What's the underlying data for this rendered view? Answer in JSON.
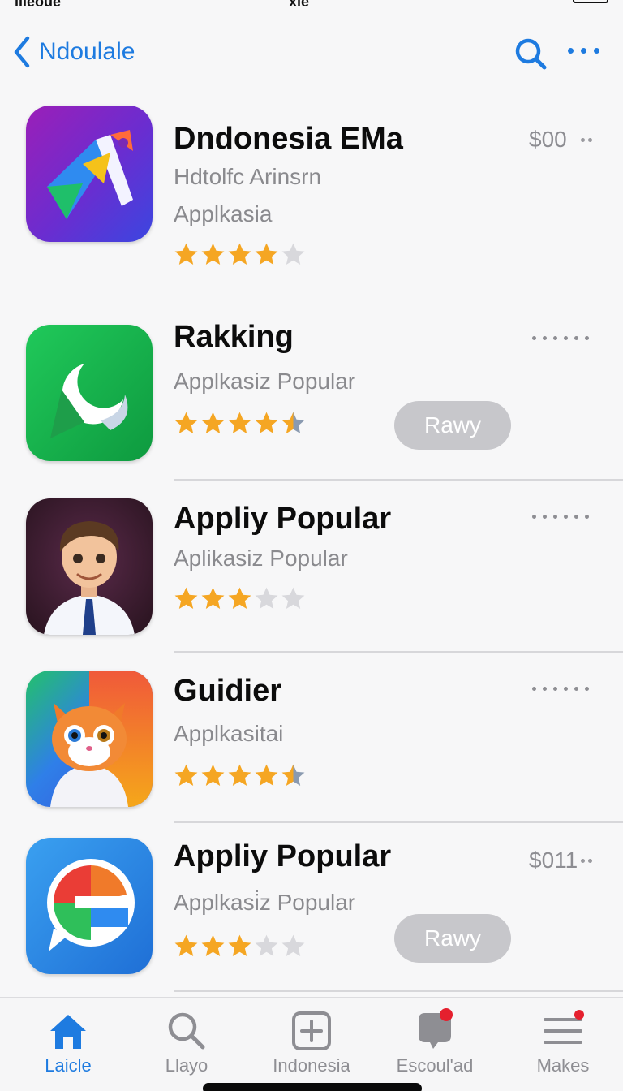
{
  "status_bar": {
    "left": "ıııeoue",
    "center": "xıe"
  },
  "nav": {
    "back_label": "Ndoulale"
  },
  "apps": [
    {
      "title": "Dndonesia EMa",
      "subtitle": "Hdtolfc Arinsrn",
      "category": "Applkasia",
      "rating": 4,
      "price": "$00",
      "action": ""
    },
    {
      "title": "Rakking",
      "subtitle": "Applkasiz Popular",
      "category": "",
      "rating": 4.5,
      "price": "",
      "action": "Rawy"
    },
    {
      "title": "Appliy Popular",
      "subtitle": "Aplikasiz Popular",
      "category": "",
      "rating": 3,
      "price": "",
      "action": ""
    },
    {
      "title": "Guidier",
      "subtitle": "Applkasitai",
      "category": "",
      "rating": 4.5,
      "price": "",
      "action": ""
    },
    {
      "title": "Appliy Popular",
      "subtitle": "Applkasi̇z Popular",
      "category": "",
      "rating": 3,
      "price": "$011",
      "action": "Rawy"
    }
  ],
  "tabs": [
    {
      "label": "Laicle",
      "icon": "house-icon",
      "active": true
    },
    {
      "label": "Llayo",
      "icon": "search-icon",
      "active": false
    },
    {
      "label": "Indonesia",
      "icon": "plus-square-icon",
      "active": false
    },
    {
      "label": "Escoul'ad",
      "icon": "speech-bubble-icon",
      "active": false,
      "badge": true
    },
    {
      "label": "Makes",
      "icon": "menu-lines-icon",
      "active": false,
      "badge": true
    }
  ],
  "colors": {
    "accent": "#1e7be0",
    "star_gold": "#f5a623",
    "star_empty": "#d8d8dc",
    "badge_red": "#e5202e"
  }
}
